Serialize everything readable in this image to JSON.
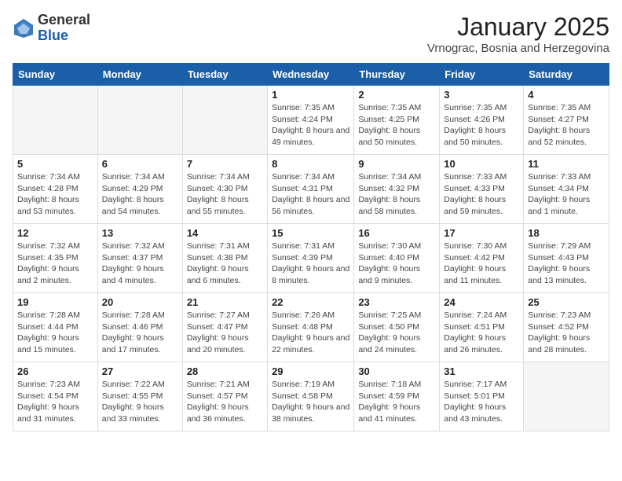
{
  "logo": {
    "general": "General",
    "blue": "Blue"
  },
  "title": {
    "month_year": "January 2025",
    "location": "Vrnograc, Bosnia and Herzegovina"
  },
  "weekdays": [
    "Sunday",
    "Monday",
    "Tuesday",
    "Wednesday",
    "Thursday",
    "Friday",
    "Saturday"
  ],
  "weeks": [
    [
      {
        "day": "",
        "info": ""
      },
      {
        "day": "",
        "info": ""
      },
      {
        "day": "",
        "info": ""
      },
      {
        "day": "1",
        "info": "Sunrise: 7:35 AM\nSunset: 4:24 PM\nDaylight: 8 hours and 49 minutes."
      },
      {
        "day": "2",
        "info": "Sunrise: 7:35 AM\nSunset: 4:25 PM\nDaylight: 8 hours and 50 minutes."
      },
      {
        "day": "3",
        "info": "Sunrise: 7:35 AM\nSunset: 4:26 PM\nDaylight: 8 hours and 50 minutes."
      },
      {
        "day": "4",
        "info": "Sunrise: 7:35 AM\nSunset: 4:27 PM\nDaylight: 8 hours and 52 minutes."
      }
    ],
    [
      {
        "day": "5",
        "info": "Sunrise: 7:34 AM\nSunset: 4:28 PM\nDaylight: 8 hours and 53 minutes."
      },
      {
        "day": "6",
        "info": "Sunrise: 7:34 AM\nSunset: 4:29 PM\nDaylight: 8 hours and 54 minutes."
      },
      {
        "day": "7",
        "info": "Sunrise: 7:34 AM\nSunset: 4:30 PM\nDaylight: 8 hours and 55 minutes."
      },
      {
        "day": "8",
        "info": "Sunrise: 7:34 AM\nSunset: 4:31 PM\nDaylight: 8 hours and 56 minutes."
      },
      {
        "day": "9",
        "info": "Sunrise: 7:34 AM\nSunset: 4:32 PM\nDaylight: 8 hours and 58 minutes."
      },
      {
        "day": "10",
        "info": "Sunrise: 7:33 AM\nSunset: 4:33 PM\nDaylight: 8 hours and 59 minutes."
      },
      {
        "day": "11",
        "info": "Sunrise: 7:33 AM\nSunset: 4:34 PM\nDaylight: 9 hours and 1 minute."
      }
    ],
    [
      {
        "day": "12",
        "info": "Sunrise: 7:32 AM\nSunset: 4:35 PM\nDaylight: 9 hours and 2 minutes."
      },
      {
        "day": "13",
        "info": "Sunrise: 7:32 AM\nSunset: 4:37 PM\nDaylight: 9 hours and 4 minutes."
      },
      {
        "day": "14",
        "info": "Sunrise: 7:31 AM\nSunset: 4:38 PM\nDaylight: 9 hours and 6 minutes."
      },
      {
        "day": "15",
        "info": "Sunrise: 7:31 AM\nSunset: 4:39 PM\nDaylight: 9 hours and 8 minutes."
      },
      {
        "day": "16",
        "info": "Sunrise: 7:30 AM\nSunset: 4:40 PM\nDaylight: 9 hours and 9 minutes."
      },
      {
        "day": "17",
        "info": "Sunrise: 7:30 AM\nSunset: 4:42 PM\nDaylight: 9 hours and 11 minutes."
      },
      {
        "day": "18",
        "info": "Sunrise: 7:29 AM\nSunset: 4:43 PM\nDaylight: 9 hours and 13 minutes."
      }
    ],
    [
      {
        "day": "19",
        "info": "Sunrise: 7:28 AM\nSunset: 4:44 PM\nDaylight: 9 hours and 15 minutes."
      },
      {
        "day": "20",
        "info": "Sunrise: 7:28 AM\nSunset: 4:46 PM\nDaylight: 9 hours and 17 minutes."
      },
      {
        "day": "21",
        "info": "Sunrise: 7:27 AM\nSunset: 4:47 PM\nDaylight: 9 hours and 20 minutes."
      },
      {
        "day": "22",
        "info": "Sunrise: 7:26 AM\nSunset: 4:48 PM\nDaylight: 9 hours and 22 minutes."
      },
      {
        "day": "23",
        "info": "Sunrise: 7:25 AM\nSunset: 4:50 PM\nDaylight: 9 hours and 24 minutes."
      },
      {
        "day": "24",
        "info": "Sunrise: 7:24 AM\nSunset: 4:51 PM\nDaylight: 9 hours and 26 minutes."
      },
      {
        "day": "25",
        "info": "Sunrise: 7:23 AM\nSunset: 4:52 PM\nDaylight: 9 hours and 28 minutes."
      }
    ],
    [
      {
        "day": "26",
        "info": "Sunrise: 7:23 AM\nSunset: 4:54 PM\nDaylight: 9 hours and 31 minutes."
      },
      {
        "day": "27",
        "info": "Sunrise: 7:22 AM\nSunset: 4:55 PM\nDaylight: 9 hours and 33 minutes."
      },
      {
        "day": "28",
        "info": "Sunrise: 7:21 AM\nSunset: 4:57 PM\nDaylight: 9 hours and 36 minutes."
      },
      {
        "day": "29",
        "info": "Sunrise: 7:19 AM\nSunset: 4:58 PM\nDaylight: 9 hours and 38 minutes."
      },
      {
        "day": "30",
        "info": "Sunrise: 7:18 AM\nSunset: 4:59 PM\nDaylight: 9 hours and 41 minutes."
      },
      {
        "day": "31",
        "info": "Sunrise: 7:17 AM\nSunset: 5:01 PM\nDaylight: 9 hours and 43 minutes."
      },
      {
        "day": "",
        "info": ""
      }
    ]
  ]
}
